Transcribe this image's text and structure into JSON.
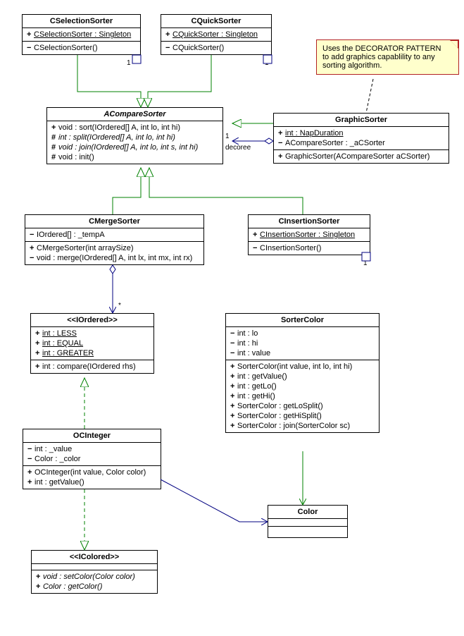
{
  "note": {
    "line1": "Uses the DECORATOR PATTERN",
    "line2": "to add graphics capablility to any",
    "line3": "sorting algorithm."
  },
  "classes": {
    "cselectionsorter": {
      "title": "CSelectionSorter",
      "attr1": {
        "vis": "+",
        "text": "CSelectionSorter : Singleton"
      },
      "op1": {
        "vis": "−",
        "text": "CSelectionSorter()"
      }
    },
    "cquicksorter": {
      "title": "CQuickSorter",
      "attr1": {
        "vis": "+",
        "text": "CQuickSorter : Singleton"
      },
      "op1": {
        "vis": "−",
        "text": "CQuickSorter()"
      }
    },
    "acomparesorter": {
      "title": "ACompareSorter",
      "op1": {
        "vis": "+",
        "text": "void : sort(IOrdered[] A, int lo, int hi)"
      },
      "op2": {
        "vis": "#",
        "text": "int : split(IOrdered[] A, int lo, int hi)"
      },
      "op3": {
        "vis": "#",
        "text": "void : join(IOrdered[] A, int lo, int s, int hi)"
      },
      "op4": {
        "vis": "#",
        "text": "void : init()"
      }
    },
    "graphicsorter": {
      "title": "GraphicSorter",
      "attr1": {
        "vis": "+",
        "text": "int : NapDuration"
      },
      "attr2": {
        "vis": "−",
        "text": "ACompareSorter : _aCSorter"
      },
      "op1": {
        "vis": "+",
        "text": "GraphicSorter(ACompareSorter aCSorter)"
      }
    },
    "cmergesorter": {
      "title": "CMergeSorter",
      "attr1": {
        "vis": "−",
        "text": "IOrdered[] : _tempA"
      },
      "op1": {
        "vis": "+",
        "text": "CMergeSorter(int arraySize)"
      },
      "op2": {
        "vis": "−",
        "text": "void : merge(IOrdered[] A, int lx, int mx, int rx)"
      }
    },
    "cinsertionsorter": {
      "title": "CInsertionSorter",
      "attr1": {
        "vis": "+",
        "text": "CInsertionSorter : Singleton"
      },
      "op1": {
        "vis": "−",
        "text": "CInsertionSorter()"
      }
    },
    "iordered": {
      "title": "<<IOrdered>>",
      "attr1": {
        "vis": "+",
        "text": "int : LESS"
      },
      "attr2": {
        "vis": "+",
        "text": "int : EQUAL"
      },
      "attr3": {
        "vis": "+",
        "text": "int : GREATER"
      },
      "op1": {
        "vis": "+",
        "text": "int : compare(IOrdered rhs)"
      }
    },
    "sortercolor": {
      "title": "SorterColor",
      "attr1": {
        "vis": "−",
        "text": "int : lo"
      },
      "attr2": {
        "vis": "−",
        "text": "int : hi"
      },
      "attr3": {
        "vis": "−",
        "text": "int : value"
      },
      "op1": {
        "vis": "+",
        "text": "SorterColor(int value, int lo, int hi)"
      },
      "op2": {
        "vis": "+",
        "text": "int : getValue()"
      },
      "op3": {
        "vis": "+",
        "text": "int : getLo()"
      },
      "op4": {
        "vis": "+",
        "text": "int : getHi()"
      },
      "op5": {
        "vis": "+",
        "text": "SorterColor : getLoSplit()"
      },
      "op6": {
        "vis": "+",
        "text": "SorterColor : getHiSplit()"
      },
      "op7": {
        "vis": "+",
        "text": "SorterColor : join(SorterColor sc)"
      }
    },
    "ocinteger": {
      "title": "OCInteger",
      "attr1": {
        "vis": "−",
        "text": "int : _value"
      },
      "attr2": {
        "vis": "−",
        "text": "Color : _color"
      },
      "op1": {
        "vis": "+",
        "text": "OCInteger(int value, Color color)"
      },
      "op2": {
        "vis": "+",
        "text": "int : getValue()"
      }
    },
    "color": {
      "title": "Color"
    },
    "icolored": {
      "title": "<<IColored>>",
      "op1": {
        "vis": "+",
        "text": "void : setColor(Color color)"
      },
      "op2": {
        "vis": "+",
        "text": "Color : getColor()"
      }
    }
  },
  "labels": {
    "decoree": "decoree",
    "one_csel": "1",
    "one_cquick": "1",
    "one_cins": "1",
    "one_graphic": "1",
    "star": "*"
  }
}
